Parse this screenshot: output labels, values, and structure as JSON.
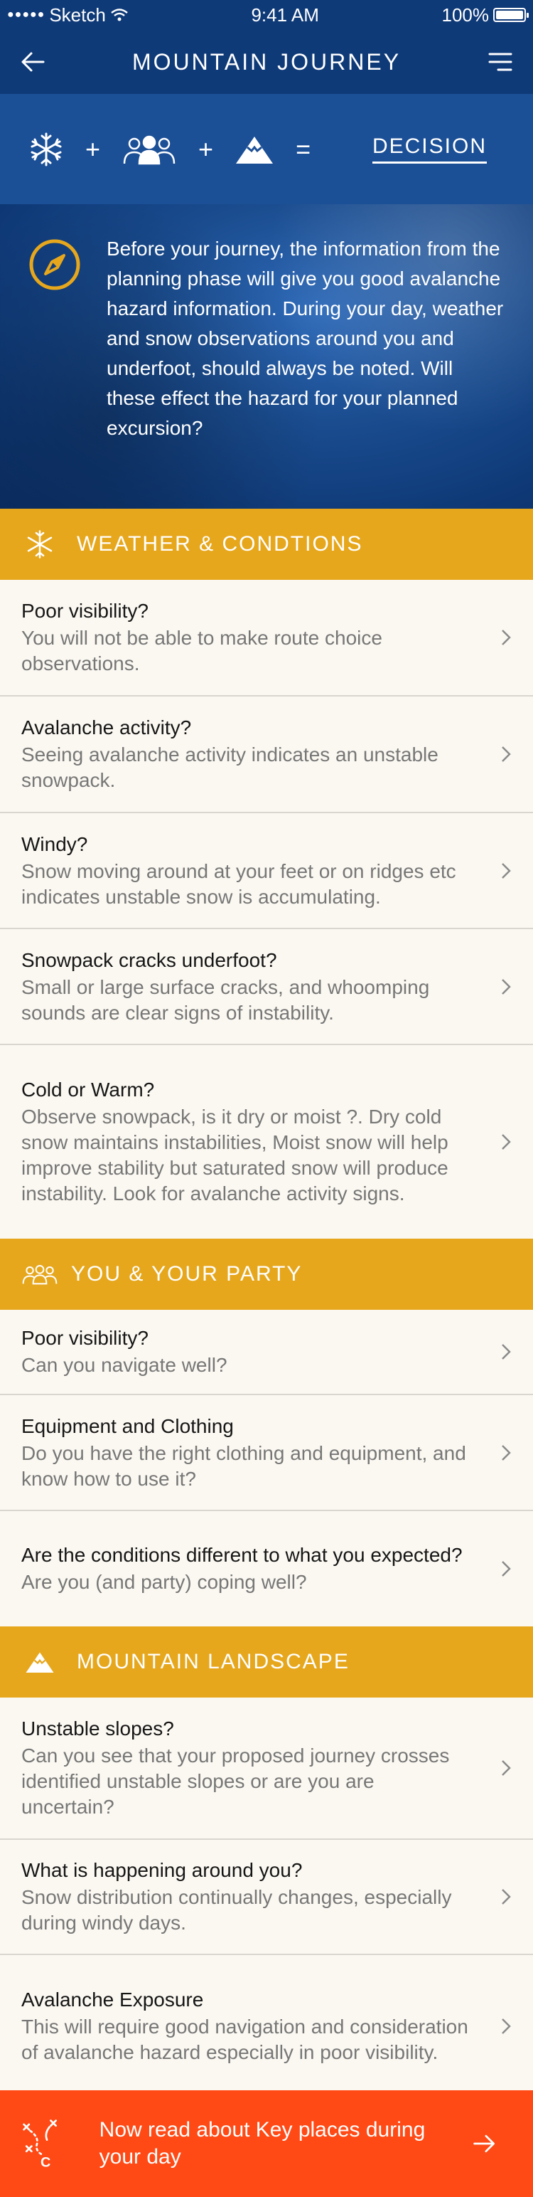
{
  "status": {
    "carrier": "Sketch",
    "time": "9:41 AM",
    "battery": "100%"
  },
  "nav": {
    "title": "MOUNTAIN JOURNEY"
  },
  "formula": {
    "plus1": "+",
    "plus2": "+",
    "equals": "=",
    "result": "DECISION"
  },
  "intro": {
    "text": "Before your journey, the information from the planning phase will give you good avalanche hazard information. During your day, weather and snow observations around you and underfoot, should always be noted. Will these effect the hazard for your planned excursion?"
  },
  "sections": [
    {
      "label": "WEATHER & CONDTIONS",
      "icon": "snowflake-icon",
      "items": [
        {
          "title": "Poor visibility?",
          "desc": "You will not be able to make route choice observations."
        },
        {
          "title": "Avalanche activity?",
          "desc": "Seeing avalanche activity indicates an unstable snowpack."
        },
        {
          "title": "Windy?",
          "desc": "Snow moving around at your feet or on ridges etc indicates unstable snow is accumulating."
        },
        {
          "title": "Snowpack cracks underfoot?",
          "desc": "Small or large surface cracks, and whoomping sounds are clear signs of instability."
        },
        {
          "title": "Cold or Warm?",
          "desc": "Observe snowpack, is it dry or moist ?. Dry cold snow maintains instabilities, Moist snow will help improve stability but saturated snow will produce instability. Look for avalanche activity signs."
        }
      ]
    },
    {
      "label": "YOU & YOUR PARTY",
      "icon": "group-icon",
      "items": [
        {
          "title": "Poor visibility?",
          "desc": "Can you navigate well?"
        },
        {
          "title": "Equipment and Clothing",
          "desc": "Do you have the right clothing and equipment, and know how to use it?"
        },
        {
          "title": "Are the conditions different to what you expected?",
          "desc": "Are you (and party) coping well?"
        }
      ]
    },
    {
      "label": "MOUNTAIN LANDSCAPE",
      "icon": "mountain-icon",
      "items": [
        {
          "title": "Unstable slopes?",
          "desc": "Can you see that your proposed journey crosses identified unstable slopes or are you are uncertain?"
        },
        {
          "title": "What is happening around you?",
          "desc": "Snow distribution continually changes, especially during windy days."
        },
        {
          "title": "Avalanche Exposure",
          "desc": "This will require good navigation and consideration of avalanche hazard especially in poor visibility."
        }
      ]
    }
  ],
  "footer": {
    "text": "Now read about Key places during your day"
  },
  "colors": {
    "navy": "#0f3a78",
    "blue": "#1b4f96",
    "gold": "#e6a71d",
    "orange": "#ff4a16"
  }
}
